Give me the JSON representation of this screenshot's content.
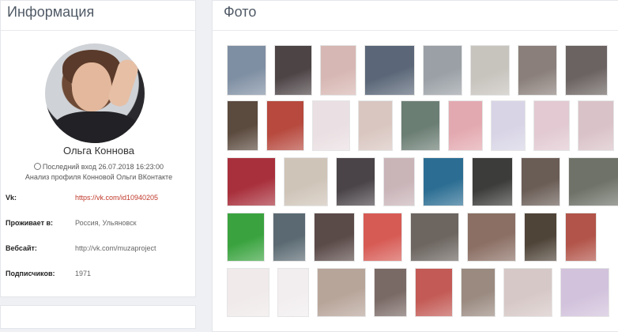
{
  "info": {
    "title": "Информация",
    "name": "Ольга Коннова",
    "last_seen": "Последний вход 26.07.2018 16:23:00",
    "subtitle": "Анализ профиля Конновой Ольги ВКонтакте",
    "fields": [
      {
        "label": "Vk:",
        "value": "https://vk.com/id10940205",
        "link": true
      },
      {
        "label": "Проживает в:",
        "value": "Россия, Ульяновск",
        "link": false
      },
      {
        "label": "Вебсайт:",
        "value": "http://vk.com/muzaproject",
        "link": false
      },
      {
        "label": "Подписчиков:",
        "value": "1971",
        "link": false
      }
    ]
  },
  "photos": {
    "title": "Фото",
    "rows": [
      [
        "#7f8fa3",
        "#4d4446",
        "#d7b7b3",
        "#5b6778",
        "#9aa0a6",
        "#c7c3bd",
        "#8a7f7a",
        "#6b6361"
      ],
      [
        "#5b4a3e",
        "#b7493e",
        "#eadfe2",
        "#d9c6c0",
        "#6b7e74",
        "#e3a9b0",
        "#d8d4e6",
        "#e2c9d2",
        "#d9c2c8"
      ],
      [
        "#a8303c",
        "#cfc4b8",
        "#4a4448",
        "#c9b4b8",
        "#2c6e93",
        "#3c3c3a",
        "#6a5d56",
        "#6e7268"
      ],
      [
        "#3aa33f",
        "#5b6a72",
        "#5a4a48",
        "#d75b55",
        "#6c6560",
        "#8b6f64",
        "#4f4438",
        "#b25449"
      ],
      [
        "#f0eaea",
        "#f2eef0",
        "#b8a59a",
        "#7a6a66",
        "#c35a55",
        "#9a8a80",
        "#d6c8c6",
        "#d2c2dc"
      ]
    ]
  }
}
